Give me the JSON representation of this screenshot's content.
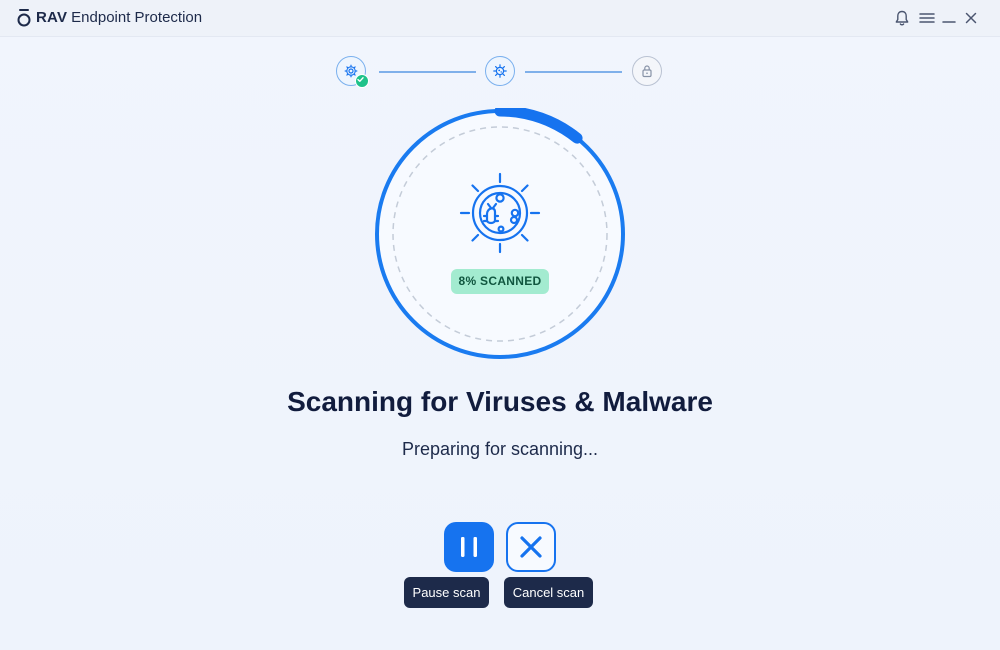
{
  "window": {
    "brand": "RAV",
    "title": "Endpoint Protection"
  },
  "titlebar_icons": [
    "bell-icon",
    "menu-icon",
    "minimize-icon",
    "close-icon"
  ],
  "steps": [
    {
      "name": "settings",
      "icon": "gear-icon",
      "status": "completed"
    },
    {
      "name": "scan",
      "icon": "virus-icon",
      "status": "active"
    },
    {
      "name": "lock",
      "icon": "lock-icon",
      "status": "pending"
    }
  ],
  "scan": {
    "progress_percent": 8,
    "badge": "8% SCANNED",
    "headline": "Scanning for Viruses & Malware",
    "status": "Preparing for scanning..."
  },
  "actions": {
    "pause_tooltip": "Pause scan",
    "cancel_tooltip": "Cancel scan"
  },
  "colors": {
    "accent": "#1673ef",
    "success": "#1fc28a",
    "badge_bg": "#a3ebd0",
    "dark": "#1d2a4a"
  }
}
